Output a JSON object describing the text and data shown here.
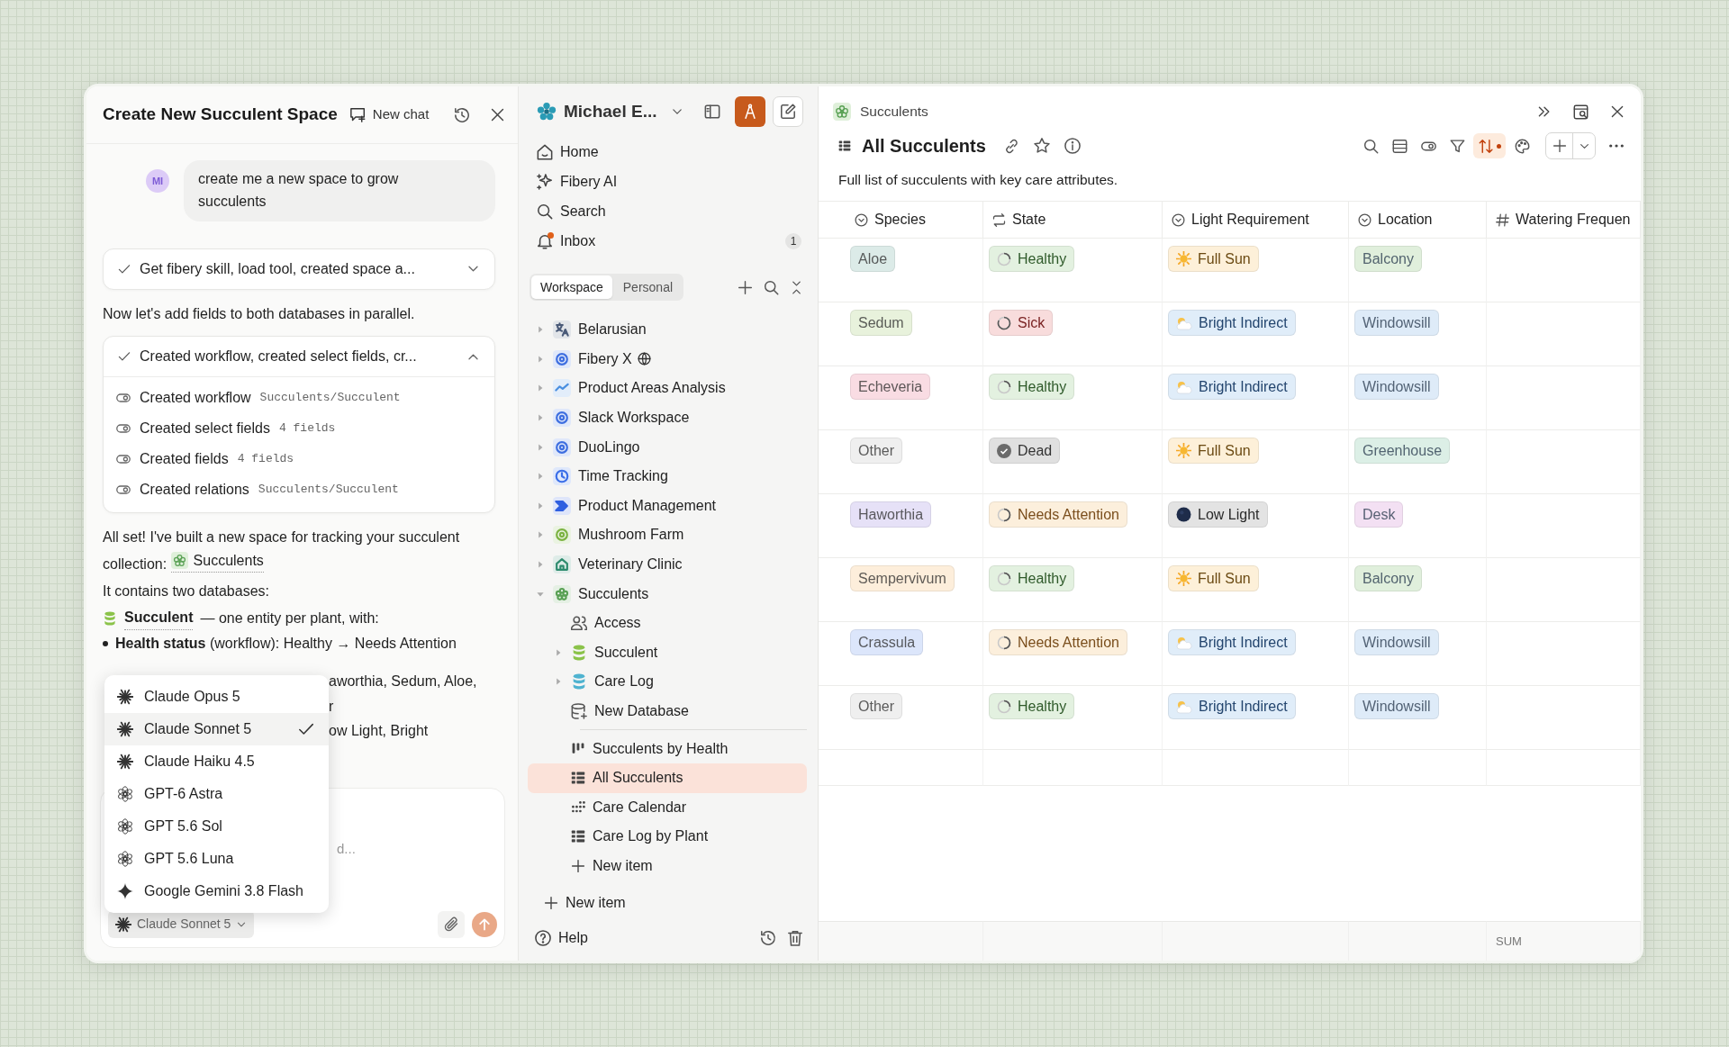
{
  "chat": {
    "title": "Create New Succulent Space",
    "new_chat": "New chat",
    "messages": [
      {
        "kind": "user",
        "initials": "MI",
        "text": "create me a new space to grow succulents"
      },
      {
        "kind": "step",
        "summary": "Get fibery skill, load tool, created space a...",
        "expanded": false
      },
      {
        "kind": "text",
        "text": "Now let's add fields to both databases in parallel."
      },
      {
        "kind": "step",
        "summary": "Created workflow, created select fields, cr...",
        "expanded": true,
        "items": [
          {
            "label": "Created workflow",
            "detail": "Succulents/Succulent"
          },
          {
            "label": "Created select fields",
            "detail": "4 fields"
          },
          {
            "label": "Created fields",
            "detail": "4 fields"
          },
          {
            "label": "Created relations",
            "detail": "Succulents/Succulent"
          }
        ]
      },
      {
        "kind": "link_text",
        "text": "All set! I've built a new space for tracking your succulent collection:",
        "link": "Succulents"
      },
      {
        "kind": "text",
        "text": "It contains two databases:"
      },
      {
        "kind": "database",
        "name": "Succulent",
        "text": "— one entity per plant, with:"
      },
      {
        "kind": "bullet",
        "text": "**Health status** (workflow): Healthy → Needs Attention"
      },
      {
        "kind": "fragment",
        "text": "aworthia, Sedum, Aloe,"
      },
      {
        "kind": "fragment",
        "text": "r"
      },
      {
        "kind": "fragment",
        "text": "ow Light, Bright"
      }
    ],
    "composer": {
      "placeholder": "d...",
      "model": "Claude Sonnet 5"
    },
    "model_menu": [
      {
        "name": "Claude Opus 5",
        "kind": "claude",
        "selected": false
      },
      {
        "name": "Claude Sonnet 5",
        "kind": "claude",
        "selected": true
      },
      {
        "name": "Claude Haiku 4.5",
        "kind": "claude",
        "selected": false
      },
      {
        "name": "GPT-6 Astra",
        "kind": "gpt",
        "selected": false
      },
      {
        "name": "GPT 5.6 Sol",
        "kind": "gpt",
        "selected": false
      },
      {
        "name": "GPT 5.6 Luna",
        "kind": "gpt",
        "selected": false
      },
      {
        "name": "Google Gemini 3.8 Flash",
        "kind": "gemini",
        "selected": false
      }
    ]
  },
  "sidebar": {
    "workspace": "Michael E...",
    "nav": [
      {
        "label": "Home",
        "kind": "home"
      },
      {
        "label": "Fibery AI",
        "kind": "ai"
      },
      {
        "label": "Search",
        "kind": "search"
      },
      {
        "label": "Inbox",
        "kind": "inbox",
        "badge": "1",
        "unread": true
      }
    ],
    "tabs": [
      {
        "label": "Workspace",
        "selected": true
      },
      {
        "label": "Personal",
        "selected": false
      }
    ],
    "tree": [
      {
        "label": "Belarusian",
        "kind": "space",
        "color": "#4a5a78",
        "expanded": false,
        "selected": false
      },
      {
        "label": "Fibery X",
        "kind": "space",
        "color": "#3f6fe0",
        "expanded": false,
        "selected": false,
        "public": true
      },
      {
        "label": "Product Areas Analysis",
        "kind": "space",
        "color": "#4a8fe0",
        "expanded": false,
        "selected": false
      },
      {
        "label": "Slack Workspace",
        "kind": "space",
        "color": "#3f6fe0",
        "expanded": false,
        "selected": false
      },
      {
        "label": "DuoLingo",
        "kind": "space",
        "color": "#3f6fe0",
        "expanded": false,
        "selected": false
      },
      {
        "label": "Time Tracking",
        "kind": "space",
        "color": "#3a6ee8",
        "expanded": false,
        "selected": false
      },
      {
        "label": "Product Management",
        "kind": "space",
        "color": "#2f5fe0",
        "expanded": false,
        "selected": false
      },
      {
        "label": "Mushroom Farm",
        "kind": "space",
        "color": "#7cb342",
        "expanded": false,
        "selected": false
      },
      {
        "label": "Veterinary Clinic",
        "kind": "space",
        "color": "#2e8b6e",
        "expanded": false,
        "selected": false
      },
      {
        "label": "Succulents",
        "kind": "space",
        "color": "#5aa155",
        "expanded": true,
        "selected": false,
        "children": [
          {
            "label": "Access",
            "kind": "access",
            "selected": false
          },
          {
            "label": "Succulent",
            "kind": "database",
            "color": "#8bc34a",
            "expanded": false,
            "selected": false
          },
          {
            "label": "Care Log",
            "kind": "database",
            "color": "#4fb3d0",
            "expanded": false,
            "selected": false
          },
          {
            "label": "New Database",
            "kind": "new_database",
            "selected": false
          },
          {
            "label": "Succulents by Health",
            "kind": "board",
            "selected": false
          },
          {
            "label": "All Succulents",
            "kind": "table",
            "selected": true
          },
          {
            "label": "Care Calendar",
            "kind": "calendar",
            "selected": false
          },
          {
            "label": "Care Log by Plant",
            "kind": "table",
            "selected": false
          },
          {
            "label": "New item",
            "kind": "add",
            "selected": false
          }
        ]
      },
      {
        "label": "New item",
        "kind": "add",
        "selected": false
      }
    ],
    "help": "Help"
  },
  "view": {
    "breadcrumb": "Succulents",
    "title": "All Succulents",
    "description": "Full list of succulents with key care attributes.",
    "toolbar": [
      {
        "kind": "search",
        "active": false
      },
      {
        "kind": "rows",
        "active": false
      },
      {
        "kind": "toggle",
        "active": false
      },
      {
        "kind": "filter",
        "active": false
      },
      {
        "kind": "sort",
        "active": true
      },
      {
        "kind": "palette",
        "active": false
      }
    ],
    "columns": [
      {
        "label": "Species",
        "kind": "select"
      },
      {
        "label": "State",
        "kind": "workflow"
      },
      {
        "label": "Light Requirement",
        "kind": "select"
      },
      {
        "label": "Location",
        "kind": "select"
      },
      {
        "label": "Watering Frequen",
        "kind": "number"
      }
    ],
    "rows": [
      {
        "species": {
          "text": "Aloe",
          "color": "#dcebe8"
        },
        "state": {
          "text": "Healthy",
          "kind": "healthy"
        },
        "light": {
          "text": "Full Sun",
          "kind": "sun"
        },
        "location": {
          "text": "Balcony",
          "color": "#e0efdc"
        }
      },
      {
        "species": {
          "text": "Sedum",
          "color": "#e8f2dc"
        },
        "state": {
          "text": "Sick",
          "kind": "sick"
        },
        "light": {
          "text": "Bright Indirect",
          "kind": "indirect"
        },
        "location": {
          "text": "Windowsill",
          "color": "#deebf8"
        }
      },
      {
        "species": {
          "text": "Echeveria",
          "color": "#f9dce3"
        },
        "state": {
          "text": "Healthy",
          "kind": "healthy"
        },
        "light": {
          "text": "Bright Indirect",
          "kind": "indirect"
        },
        "location": {
          "text": "Windowsill",
          "color": "#deebf8"
        }
      },
      {
        "species": {
          "text": "Other",
          "color": "#efefef"
        },
        "state": {
          "text": "Dead",
          "kind": "dead"
        },
        "light": {
          "text": "Full Sun",
          "kind": "sun"
        },
        "location": {
          "text": "Greenhouse",
          "color": "#dcefe6"
        }
      },
      {
        "species": {
          "text": "Haworthia",
          "color": "#e6e1f7"
        },
        "state": {
          "text": "Needs Attention",
          "kind": "attention"
        },
        "light": {
          "text": "Low Light",
          "kind": "low"
        },
        "location": {
          "text": "Desk",
          "color": "#f3e0f3"
        }
      },
      {
        "species": {
          "text": "Sempervivum",
          "color": "#fdeedb"
        },
        "state": {
          "text": "Healthy",
          "kind": "healthy"
        },
        "light": {
          "text": "Full Sun",
          "kind": "sun"
        },
        "location": {
          "text": "Balcony",
          "color": "#e0efdc"
        }
      },
      {
        "species": {
          "text": "Crassula",
          "color": "#dce6fb"
        },
        "state": {
          "text": "Needs Attention",
          "kind": "attention"
        },
        "light": {
          "text": "Bright Indirect",
          "kind": "indirect"
        },
        "location": {
          "text": "Windowsill",
          "color": "#deebf8"
        }
      },
      {
        "species": {
          "text": "Other",
          "color": "#efefef"
        },
        "state": {
          "text": "Healthy",
          "kind": "healthy"
        },
        "light": {
          "text": "Bright Indirect",
          "kind": "indirect"
        },
        "location": {
          "text": "Windowsill",
          "color": "#deebf8"
        }
      }
    ],
    "sum_label": "SUM"
  }
}
